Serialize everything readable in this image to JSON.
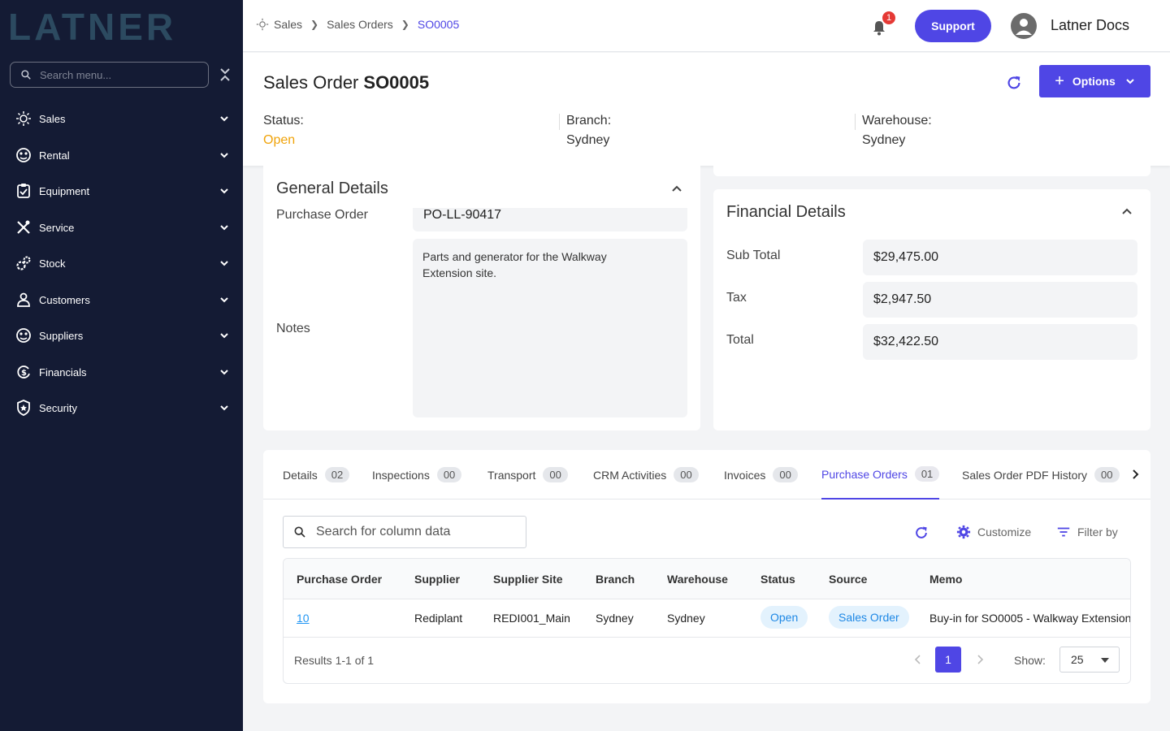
{
  "brand": {
    "logo_text": "LATNER"
  },
  "sidebar": {
    "search_placeholder": "Search menu...",
    "items": [
      {
        "label": "Sales"
      },
      {
        "label": "Rental"
      },
      {
        "label": "Equipment"
      },
      {
        "label": "Service"
      },
      {
        "label": "Stock"
      },
      {
        "label": "Customers"
      },
      {
        "label": "Suppliers"
      },
      {
        "label": "Financials"
      },
      {
        "label": "Security"
      }
    ]
  },
  "header": {
    "breadcrumb": [
      "Sales",
      "Sales Orders",
      "SO0005"
    ],
    "notification_count": "1",
    "support_label": "Support",
    "user_name": "Latner Docs"
  },
  "page": {
    "title_prefix": "Sales Order",
    "title_id": "SO0005",
    "options_label": "Options",
    "status_label": "Status:",
    "status_value": "Open",
    "branch_label": "Branch:",
    "branch_value": "Sydney",
    "warehouse_label": "Warehouse:",
    "warehouse_value": "Sydney"
  },
  "general": {
    "title": "General Details",
    "purchase_order_label": "Purchase Order",
    "purchase_order_value": "PO-LL-90417",
    "notes_label": "Notes",
    "notes_value": "Parts and generator for the Walkway Extension site."
  },
  "financial": {
    "title": "Financial Details",
    "subtotal_label": "Sub Total",
    "subtotal_value": "$29,475.00",
    "tax_label": "Tax",
    "tax_value": "$2,947.50",
    "total_label": "Total",
    "total_value": "$32,422.50"
  },
  "tabs": [
    {
      "label": "Details",
      "count": "02"
    },
    {
      "label": "Inspections",
      "count": "00"
    },
    {
      "label": "Transport",
      "count": "00"
    },
    {
      "label": "CRM Activities",
      "count": "00"
    },
    {
      "label": "Invoices",
      "count": "00"
    },
    {
      "label": "Purchase Orders",
      "count": "01"
    },
    {
      "label": "Sales Order PDF History",
      "count": "00"
    }
  ],
  "grid": {
    "search_placeholder": "Search for column data",
    "customize_label": "Customize",
    "filter_label": "Filter by",
    "columns": [
      "Purchase Order",
      "Supplier",
      "Supplier Site",
      "Branch",
      "Warehouse",
      "Status",
      "Source",
      "Memo"
    ],
    "rows": [
      {
        "purchase_order": "10",
        "supplier": "Rediplant",
        "supplier_site": "REDI001_Main",
        "branch": "Sydney",
        "warehouse": "Sydney",
        "status": "Open",
        "source": "Sales Order",
        "memo": "Buy-in for SO0005 - Walkway Extension"
      }
    ],
    "results_text": "Results 1-1 of 1",
    "current_page": "1",
    "show_label": "Show:",
    "page_size": "25"
  },
  "colors": {
    "accent": "#4f46e5",
    "sidebar_bg": "#141b34",
    "status_open": "#f0a30a"
  }
}
